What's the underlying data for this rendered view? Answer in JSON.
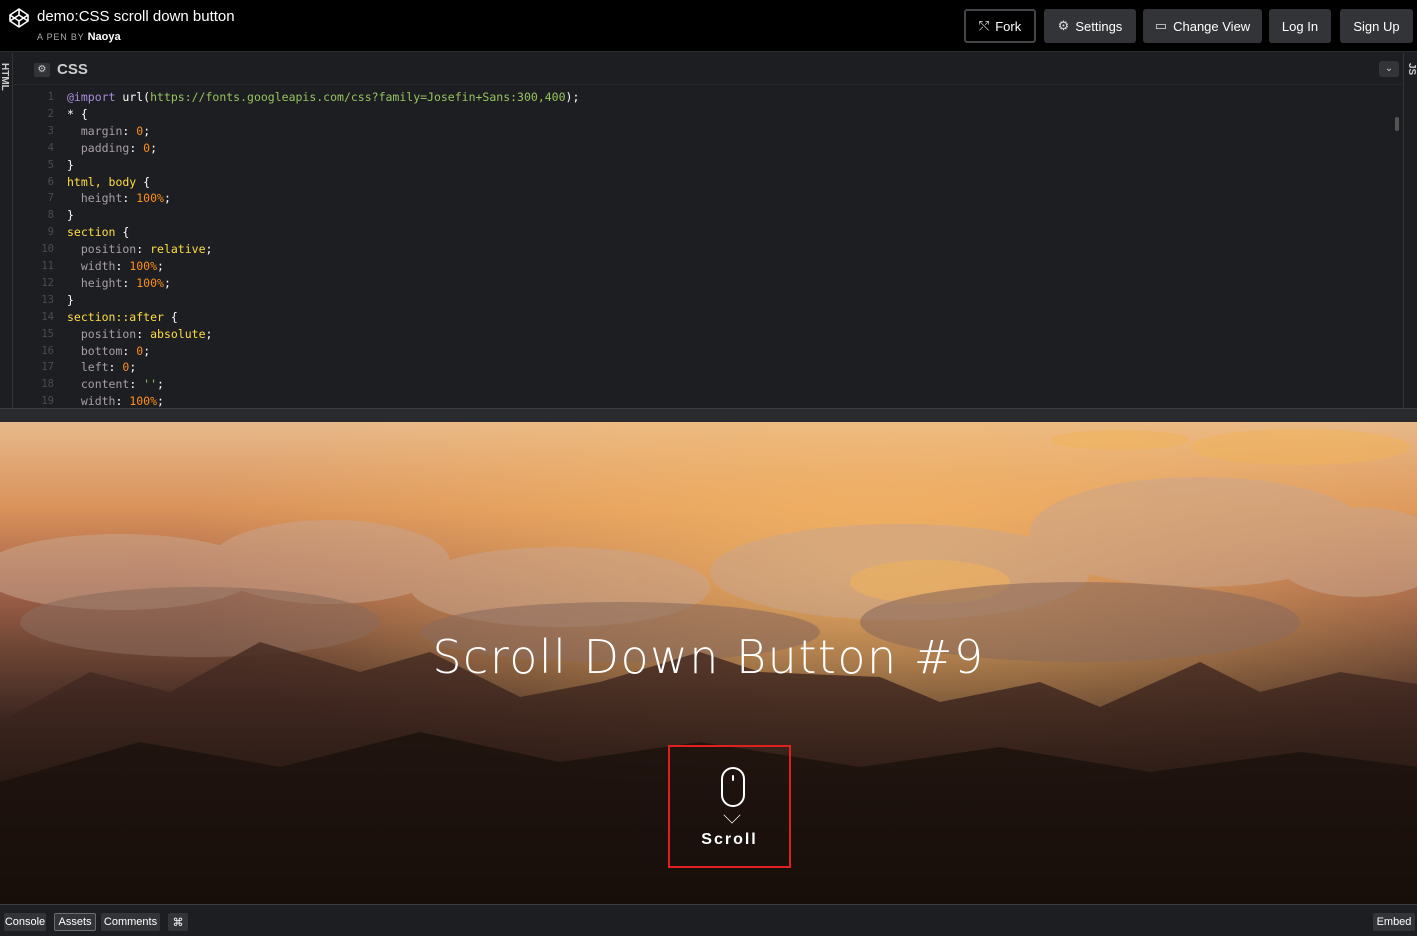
{
  "header": {
    "pen_title": "demo:CSS scroll down button",
    "byline_prefix": "A PEN BY",
    "author": "Naoya",
    "buttons": {
      "fork": "Fork",
      "settings": "Settings",
      "change_view": "Change View",
      "log_in": "Log In",
      "sign_up": "Sign Up"
    }
  },
  "editor": {
    "left_tab": "HTML",
    "right_tab": "JS",
    "name": "CSS",
    "lines": [
      {
        "n": "1",
        "tokens": [
          [
            "c-kw",
            "@import"
          ],
          [
            "c-p",
            " url("
          ],
          [
            "c-str",
            "https://fonts.googleapis.com/css?family=Josefin+Sans:300,400"
          ],
          [
            "c-p",
            ");"
          ]
        ]
      },
      {
        "n": "2",
        "tokens": [
          [
            "c-p",
            "* {"
          ]
        ]
      },
      {
        "n": "3",
        "tokens": [
          [
            "c-prop",
            "  margin"
          ],
          [
            "c-p",
            ": "
          ],
          [
            "c-num",
            "0"
          ],
          [
            "c-p",
            ";"
          ]
        ]
      },
      {
        "n": "4",
        "tokens": [
          [
            "c-prop",
            "  padding"
          ],
          [
            "c-p",
            ": "
          ],
          [
            "c-num",
            "0"
          ],
          [
            "c-p",
            ";"
          ]
        ]
      },
      {
        "n": "5",
        "tokens": [
          [
            "c-p",
            "}"
          ]
        ]
      },
      {
        "n": "6",
        "tokens": [
          [
            "c-sel",
            "html, body"
          ],
          [
            "c-p",
            " {"
          ]
        ]
      },
      {
        "n": "7",
        "tokens": [
          [
            "c-prop",
            "  height"
          ],
          [
            "c-p",
            ": "
          ],
          [
            "c-num",
            "100%"
          ],
          [
            "c-p",
            ";"
          ]
        ]
      },
      {
        "n": "8",
        "tokens": [
          [
            "c-p",
            "}"
          ]
        ]
      },
      {
        "n": "9",
        "tokens": [
          [
            "c-sel",
            "section"
          ],
          [
            "c-p",
            " {"
          ]
        ]
      },
      {
        "n": "10",
        "tokens": [
          [
            "c-prop",
            "  position"
          ],
          [
            "c-p",
            ": "
          ],
          [
            "c-val",
            "relative"
          ],
          [
            "c-p",
            ";"
          ]
        ]
      },
      {
        "n": "11",
        "tokens": [
          [
            "c-prop",
            "  width"
          ],
          [
            "c-p",
            ": "
          ],
          [
            "c-num",
            "100%"
          ],
          [
            "c-p",
            ";"
          ]
        ]
      },
      {
        "n": "12",
        "tokens": [
          [
            "c-prop",
            "  height"
          ],
          [
            "c-p",
            ": "
          ],
          [
            "c-num",
            "100%"
          ],
          [
            "c-p",
            ";"
          ]
        ]
      },
      {
        "n": "13",
        "tokens": [
          [
            "c-p",
            "}"
          ]
        ]
      },
      {
        "n": "14",
        "tokens": [
          [
            "c-sel",
            "section::after"
          ],
          [
            "c-p",
            " {"
          ]
        ]
      },
      {
        "n": "15",
        "tokens": [
          [
            "c-prop",
            "  position"
          ],
          [
            "c-p",
            ": "
          ],
          [
            "c-val",
            "absolute"
          ],
          [
            "c-p",
            ";"
          ]
        ]
      },
      {
        "n": "16",
        "tokens": [
          [
            "c-prop",
            "  bottom"
          ],
          [
            "c-p",
            ": "
          ],
          [
            "c-num",
            "0"
          ],
          [
            "c-p",
            ";"
          ]
        ]
      },
      {
        "n": "17",
        "tokens": [
          [
            "c-prop",
            "  left"
          ],
          [
            "c-p",
            ": "
          ],
          [
            "c-num",
            "0"
          ],
          [
            "c-p",
            ";"
          ]
        ]
      },
      {
        "n": "18",
        "tokens": [
          [
            "c-prop",
            "  content"
          ],
          [
            "c-p",
            ": "
          ],
          [
            "c-str",
            "''"
          ],
          [
            "c-p",
            ";"
          ]
        ]
      },
      {
        "n": "19",
        "tokens": [
          [
            "c-prop",
            "  width"
          ],
          [
            "c-p",
            ": "
          ],
          [
            "c-num",
            "100%"
          ],
          [
            "c-p",
            ";"
          ]
        ]
      }
    ]
  },
  "preview": {
    "title": "Scroll Down Button #9",
    "scroll_label": "Scroll",
    "highlight_color": "#e02020"
  },
  "footer": {
    "console": "Console",
    "assets": "Assets",
    "comments": "Comments",
    "shortcuts": "⌘",
    "embed": "Embed"
  },
  "icons": {
    "logo": "codepen-logo-icon",
    "fork": "fork-icon",
    "settings": "gear-icon",
    "change_view": "layout-icon",
    "collapse": "chevron-down-icon"
  }
}
